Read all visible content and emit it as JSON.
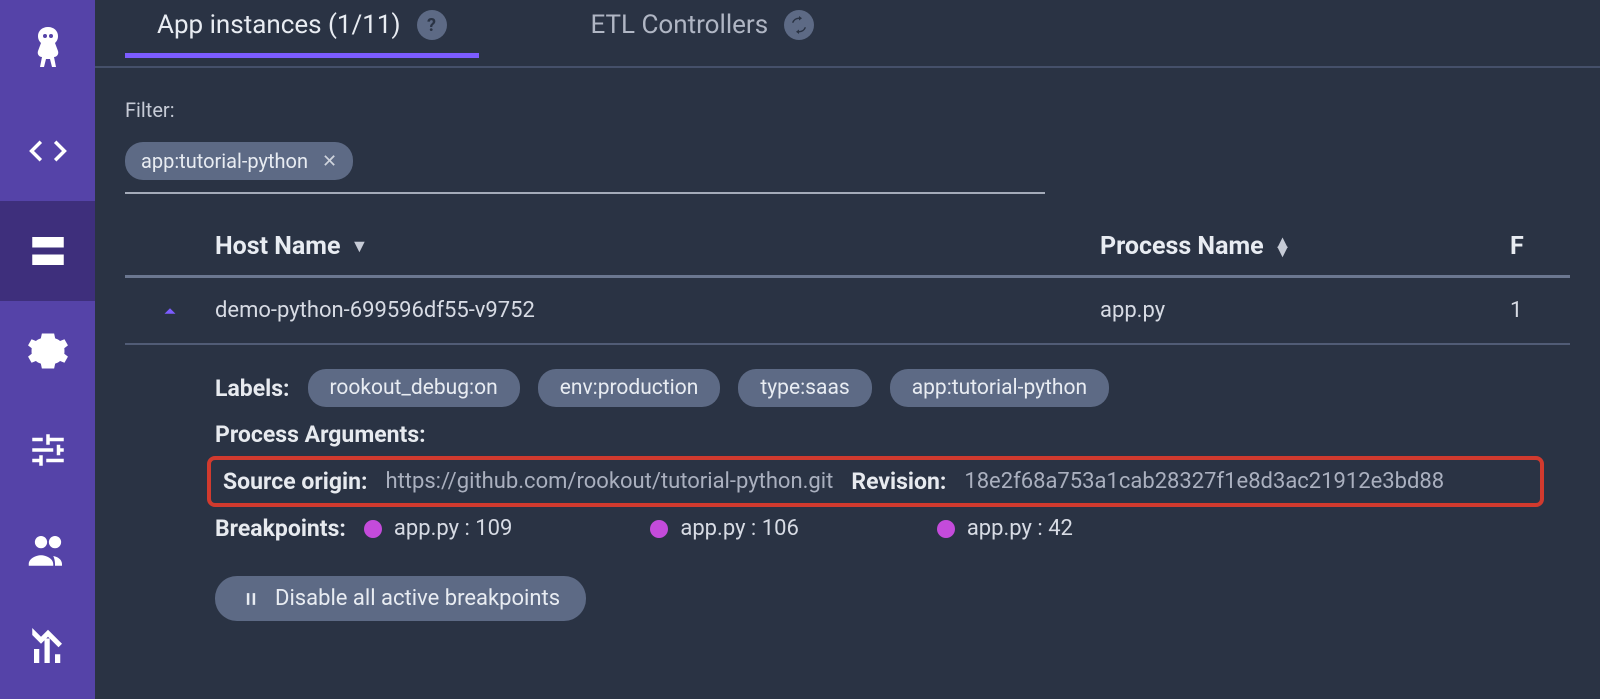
{
  "sidebar": {
    "items": [
      "logo",
      "code",
      "servers",
      "settings",
      "sliders",
      "users",
      "analytics"
    ]
  },
  "tabs": {
    "active": "App instances (1/11)",
    "inactive": "ETL Controllers"
  },
  "filter": {
    "label": "Filter:",
    "chip": "app:tutorial-python"
  },
  "table": {
    "headers": {
      "host": "Host Name",
      "process": "Process Name",
      "extra": "F"
    },
    "row": {
      "host": "demo-python-699596df55-v9752",
      "process": "app.py",
      "extra": "1"
    }
  },
  "details": {
    "labels_label": "Labels:",
    "labels": [
      "rookout_debug:on",
      "env:production",
      "type:saas",
      "app:tutorial-python"
    ],
    "process_args_label": "Process Arguments:",
    "source_origin_label": "Source origin:",
    "source_origin": "https://github.com/rookout/tutorial-python.git",
    "revision_label": "Revision:",
    "revision": "18e2f68a753a1cab28327f1e8d3ac21912e3bd88",
    "breakpoints_label": "Breakpoints:",
    "breakpoints": [
      "app.py : 109",
      "app.py : 106",
      "app.py : 42"
    ],
    "disable_btn": "Disable all active breakpoints"
  }
}
